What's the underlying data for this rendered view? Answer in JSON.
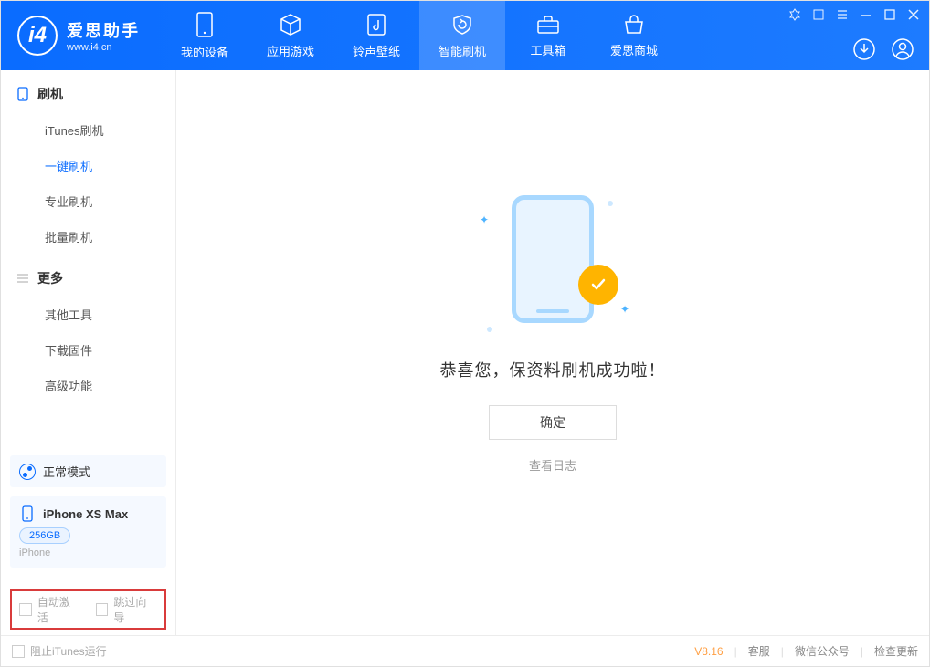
{
  "header": {
    "logo_title": "爱思助手",
    "logo_sub": "www.i4.cn",
    "tabs": [
      {
        "label": "我的设备"
      },
      {
        "label": "应用游戏"
      },
      {
        "label": "铃声壁纸"
      },
      {
        "label": "智能刷机"
      },
      {
        "label": "工具箱"
      },
      {
        "label": "爱思商城"
      }
    ]
  },
  "sidebar": {
    "section1": {
      "title": "刷机"
    },
    "items1": [
      {
        "label": "iTunes刷机"
      },
      {
        "label": "一键刷机"
      },
      {
        "label": "专业刷机"
      },
      {
        "label": "批量刷机"
      }
    ],
    "section2": {
      "title": "更多"
    },
    "items2": [
      {
        "label": "其他工具"
      },
      {
        "label": "下载固件"
      },
      {
        "label": "高级功能"
      }
    ],
    "mode_label": "正常模式",
    "device": {
      "name": "iPhone XS Max",
      "storage": "256GB",
      "type": "iPhone"
    },
    "checkbox1": "自动激活",
    "checkbox2": "跳过向导"
  },
  "main": {
    "success_msg": "恭喜您，保资料刷机成功啦！",
    "ok_button": "确定",
    "view_log": "查看日志"
  },
  "footer": {
    "block_itunes": "阻止iTunes运行",
    "version": "V8.16",
    "links": [
      "客服",
      "微信公众号",
      "检查更新"
    ]
  }
}
